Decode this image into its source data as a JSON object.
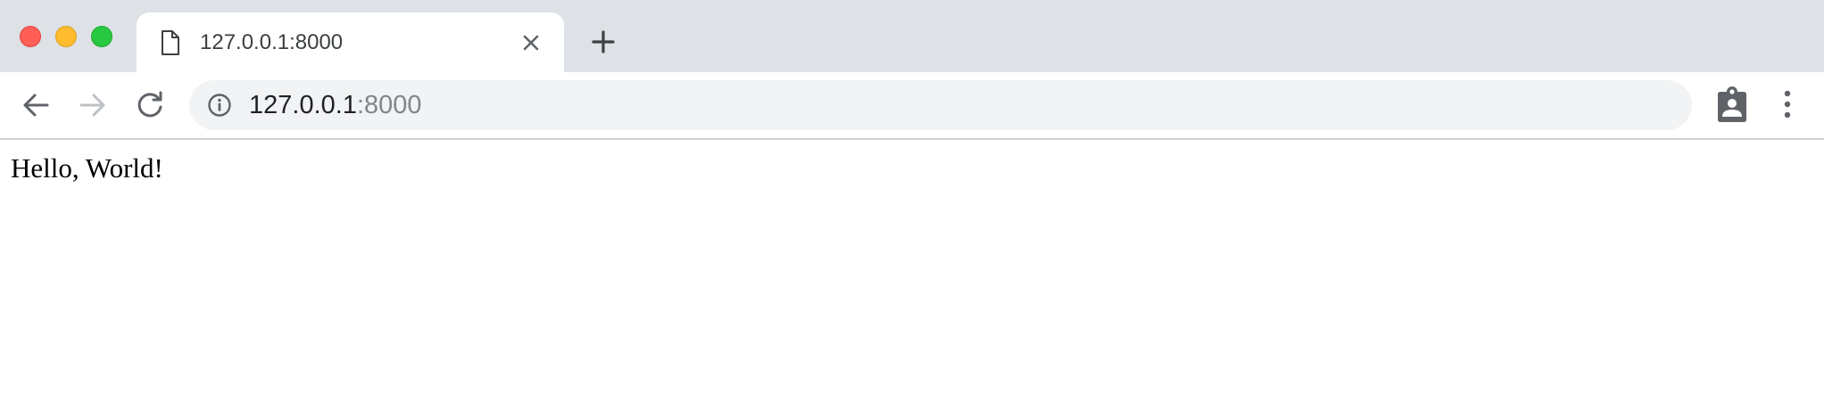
{
  "window": {
    "controls": [
      "close",
      "minimize",
      "maximize"
    ]
  },
  "tab": {
    "title": "127.0.0.1:8000",
    "favicon": "document-icon"
  },
  "toolbar": {
    "back_icon": "arrow-left-icon",
    "forward_icon": "arrow-right-icon",
    "reload_icon": "reload-icon",
    "profile_icon": "clipboard-account-icon",
    "menu_icon": "vertical-dots-icon"
  },
  "omnibox": {
    "host": "127.0.0.1",
    "port": ":8000",
    "security_icon": "info-icon"
  },
  "page": {
    "body_text": "Hello, World!"
  },
  "colors": {
    "tab_strip": "#dee1e6",
    "omnibox_bg": "#f1f3f4",
    "url_host": "#202124",
    "url_port": "#80868b",
    "close_light": "#ff5f57",
    "minimize_light": "#febc2e",
    "maximize_light": "#28c840"
  }
}
